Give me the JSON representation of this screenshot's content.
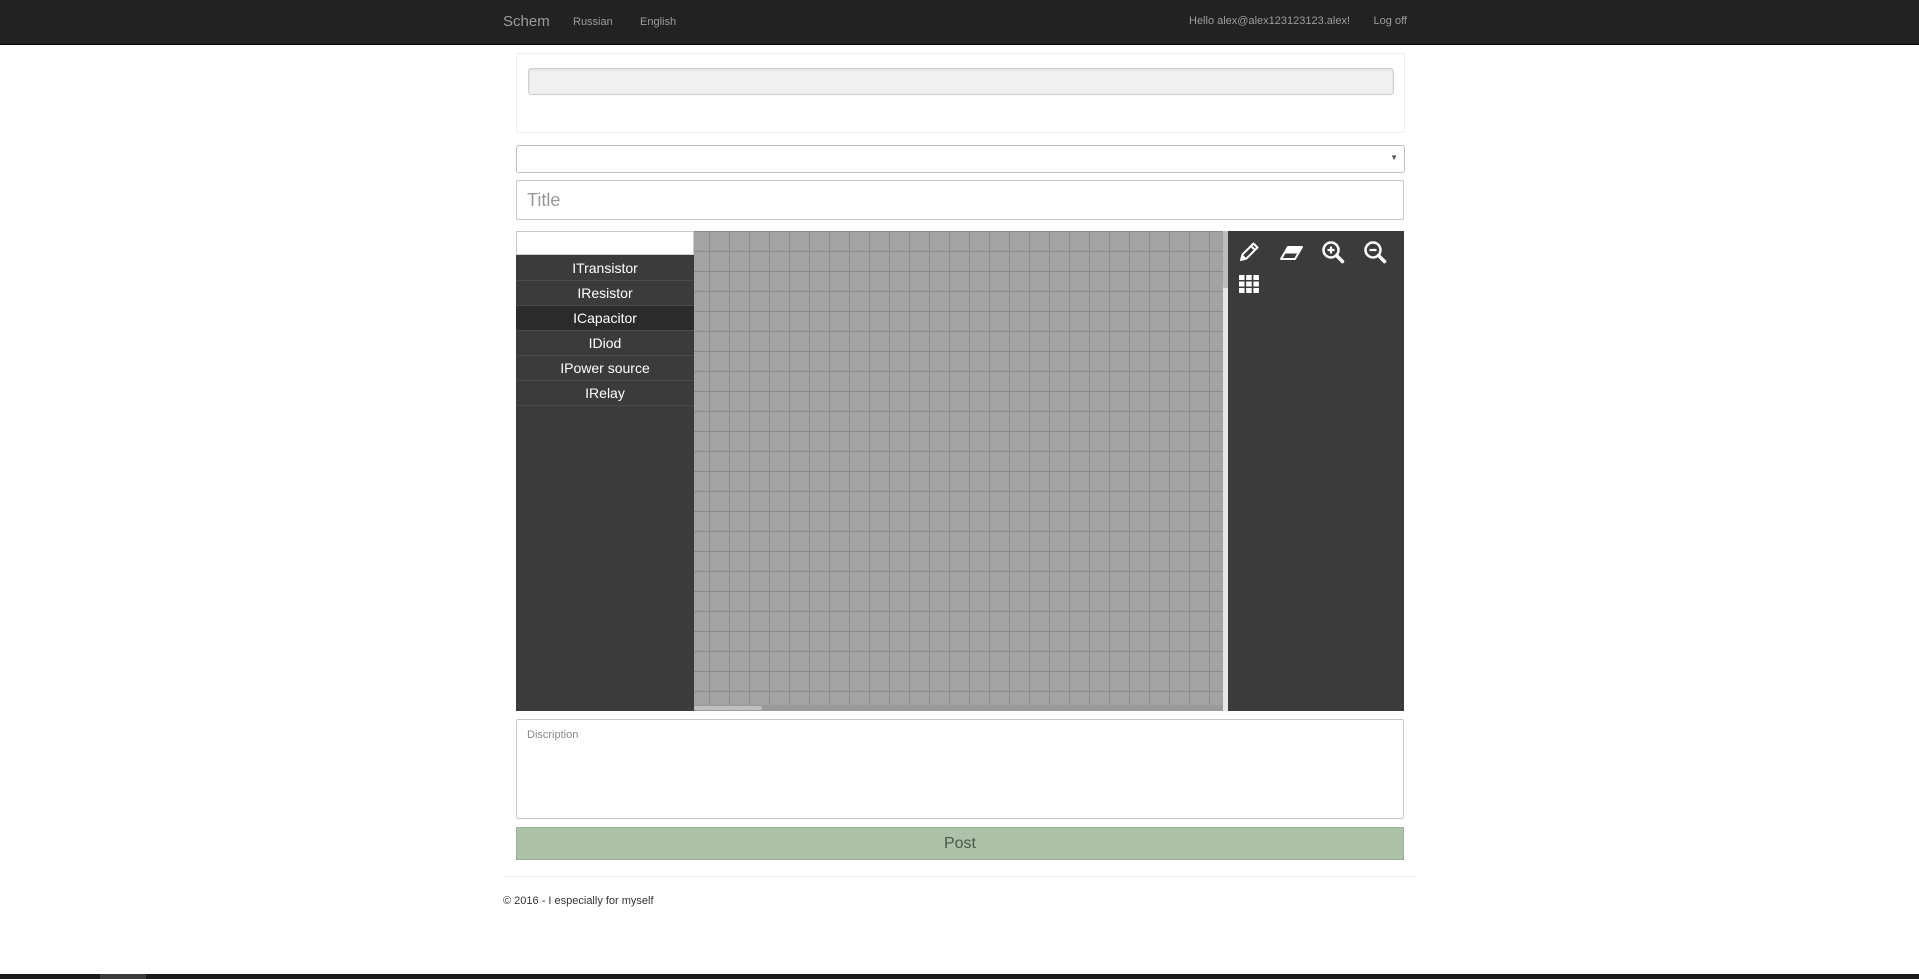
{
  "navbar": {
    "brand": "Schem",
    "lang_russian": "Russian",
    "lang_english": "English",
    "greeting": "Hello alex@alex123123123.alex!",
    "logoff": "Log off"
  },
  "upload": {
    "progress_percent": 0
  },
  "form": {
    "category_selected": "",
    "title_placeholder": "Title",
    "description_placeholder": "Discription",
    "post_label": "Post"
  },
  "editor": {
    "search_value": "",
    "components": [
      {
        "label": "ITransistor",
        "selected": false
      },
      {
        "label": "IResistor",
        "selected": false
      },
      {
        "label": "ICapacitor",
        "selected": true
      },
      {
        "label": "IDiod",
        "selected": false
      },
      {
        "label": "IPower source",
        "selected": false
      },
      {
        "label": "IRelay",
        "selected": false
      }
    ],
    "tools": [
      {
        "icon": "pencil-icon"
      },
      {
        "icon": "eraser-icon"
      },
      {
        "icon": "zoom-in-icon"
      },
      {
        "icon": "zoom-out-icon"
      },
      {
        "icon": "grid-icon"
      }
    ]
  },
  "footer": {
    "text": "© 2016 - I especially for myself"
  },
  "colors": {
    "navbar_bg": "#222222",
    "editor_panel_bg": "#3b3b3b",
    "canvas_bg": "#a3a3a3",
    "post_button_bg": "#adc2a9"
  }
}
